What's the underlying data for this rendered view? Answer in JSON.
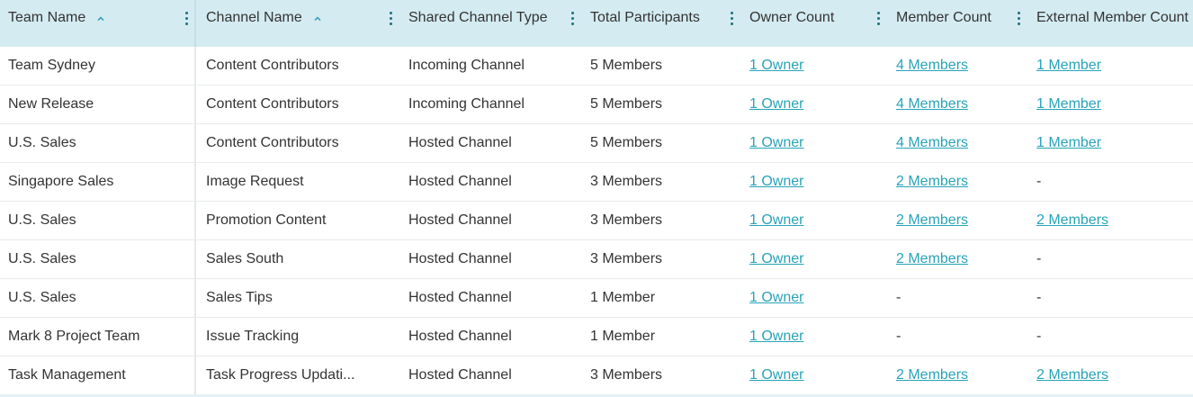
{
  "columns": [
    {
      "label": "Team Name",
      "sorted": "asc"
    },
    {
      "label": "Channel Name",
      "sorted": "asc"
    },
    {
      "label": "Shared Channel Type"
    },
    {
      "label": "Total Participants"
    },
    {
      "label": "Owner Count"
    },
    {
      "label": "Member Count"
    },
    {
      "label": "External Member Count"
    }
  ],
  "rows": [
    {
      "team": "Team Sydney",
      "channel": "Content Contributors",
      "type": "Incoming Channel",
      "total": "5 Members",
      "owners": "1 Owner",
      "members": "4 Members",
      "external": "1 Member"
    },
    {
      "team": "New Release",
      "channel": "Content Contributors",
      "type": "Incoming Channel",
      "total": "5 Members",
      "owners": "1 Owner",
      "members": "4 Members",
      "external": "1 Member"
    },
    {
      "team": "U.S. Sales",
      "channel": "Content Contributors",
      "type": "Hosted Channel",
      "total": "5 Members",
      "owners": "1 Owner",
      "members": "4 Members",
      "external": "1 Member"
    },
    {
      "team": "Singapore Sales",
      "channel": "Image Request",
      "type": "Hosted Channel",
      "total": "3 Members",
      "owners": "1 Owner",
      "members": "2 Members",
      "external": "-"
    },
    {
      "team": "U.S. Sales",
      "channel": "Promotion Content",
      "type": "Hosted Channel",
      "total": "3 Members",
      "owners": "1 Owner",
      "members": "2 Members",
      "external": "2 Members"
    },
    {
      "team": "U.S. Sales",
      "channel": "Sales South",
      "type": "Hosted Channel",
      "total": "3 Members",
      "owners": "1 Owner",
      "members": "2 Members",
      "external": "-"
    },
    {
      "team": "U.S. Sales",
      "channel": "Sales Tips",
      "type": "Hosted Channel",
      "total": "1 Member",
      "owners": "1 Owner",
      "members": "-",
      "external": "-"
    },
    {
      "team": "Mark 8 Project Team",
      "channel": "Issue Tracking",
      "type": "Hosted Channel",
      "total": "1 Member",
      "owners": "1 Owner",
      "members": "-",
      "external": "-"
    },
    {
      "team": "Task Management",
      "channel": "Task Progress Updati...",
      "type": "Hosted Channel",
      "total": "3 Members",
      "owners": "1 Owner",
      "members": "2 Members",
      "external": "2 Members"
    }
  ],
  "icons": {
    "sort": "chevron-up-icon",
    "menu": "kebab-menu-icon"
  },
  "colors": {
    "header_bg": "#d4ebf1",
    "link": "#27a3b9",
    "icon": "#1d6f7e"
  }
}
